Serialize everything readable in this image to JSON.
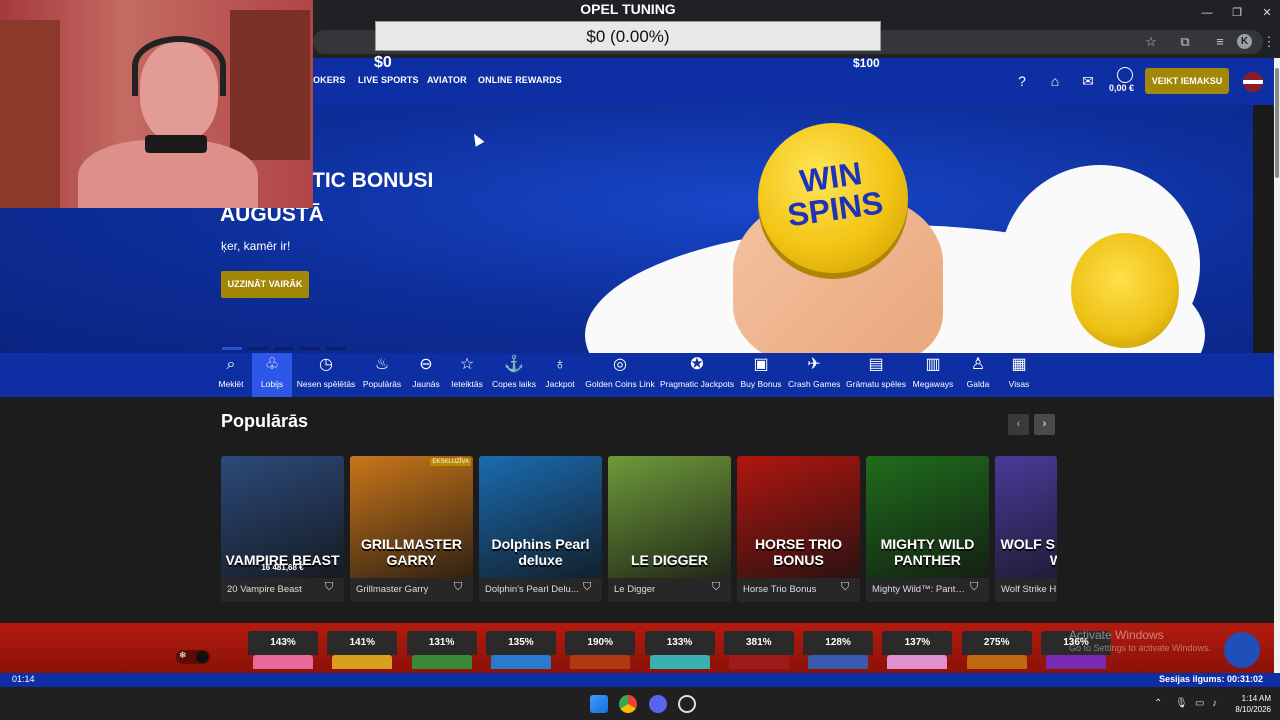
{
  "overlay": {
    "title": "OPEL TUNING",
    "progress_text": "$0 (0.00%)",
    "progress_fraction": 0.0,
    "min_label": "$0",
    "max_label": "$100"
  },
  "browser": {
    "profile_initial": "K",
    "window_controls": [
      "minimize-icon",
      "restore-icon",
      "close-icon"
    ],
    "toolbar_icons": [
      "star-icon",
      "extensions-icon",
      "media-icon",
      "menu-icon"
    ]
  },
  "header": {
    "nav": [
      "OKERS",
      "LIVE SPORTS",
      "AVIATOR",
      "ONLINE REWARDS"
    ],
    "balance": "0,00 €",
    "deposit_label": "VEIKT IEMAKSU",
    "icons": [
      "help-icon",
      "gift-icon",
      "mail-icon",
      "user-icon",
      "language-flag-icon"
    ]
  },
  "hero": {
    "title_line1": "TIC BONUSI",
    "title_line2": "AUGUSTĀ",
    "subtitle": "ķer, kamēr ir!",
    "button_label": "UZZINĀT VAIRĀK",
    "coin_text": "WIN SPINS",
    "slide_count": 5,
    "active_slide": 1
  },
  "categories": [
    {
      "label": "Meklēt",
      "icon": "search-icon",
      "glyph": "⌕"
    },
    {
      "label": "Lobijs",
      "icon": "lobby-icon",
      "glyph": "♧"
    },
    {
      "label": "Nesen spēlētās",
      "icon": "recent-icon",
      "glyph": "◷"
    },
    {
      "label": "Populārās",
      "icon": "popular-icon",
      "glyph": "♨"
    },
    {
      "label": "Jaunās",
      "icon": "new-icon",
      "glyph": "⊖"
    },
    {
      "label": "Ieteiktās",
      "icon": "star-icon",
      "glyph": "☆"
    },
    {
      "label": "Copes laiks",
      "icon": "fishing-icon",
      "glyph": "⚓"
    },
    {
      "label": "Jackpot",
      "icon": "jackpot-icon",
      "glyph": "♁"
    },
    {
      "label": "Golden Coins Link",
      "icon": "coins-icon",
      "glyph": "◎"
    },
    {
      "label": "Pragmatic Jackpots",
      "icon": "pragmatic-icon",
      "glyph": "✪"
    },
    {
      "label": "Buy Bonus",
      "icon": "wallet-icon",
      "glyph": "▣"
    },
    {
      "label": "Crash Games",
      "icon": "rocket-icon",
      "glyph": "✈"
    },
    {
      "label": "Grāmatu spēles",
      "icon": "book-icon",
      "glyph": "▤"
    },
    {
      "label": "Megaways",
      "icon": "megaways-icon",
      "glyph": "▥"
    },
    {
      "label": "Galda",
      "icon": "table-icon",
      "glyph": "♙"
    },
    {
      "label": "Visas",
      "icon": "all-games-icon",
      "glyph": "▦"
    }
  ],
  "popular": {
    "title": "Populārās",
    "prev_glyph": "‹",
    "next_glyph": "›",
    "games": [
      {
        "name": "20 Vampire Beast",
        "art": "VAMPIRE BEAST",
        "amount": "16 481,68 €",
        "color": "#2c4a7a"
      },
      {
        "name": "Grillmaster Garry",
        "art": "GRILLMASTER GARRY",
        "badge": "EKSKLUZĪVA",
        "color": "#c9761a"
      },
      {
        "name": "Dolphin's Pearl Delu...",
        "art": "Dolphins Pearl deluxe",
        "color": "#1a6bb0"
      },
      {
        "name": "Le Digger",
        "art": "LE DIGGER",
        "color": "#6e9a3a"
      },
      {
        "name": "Horse Trio Bonus",
        "art": "HORSE TRIO BONUS",
        "color": "#b0160f"
      },
      {
        "name": "Mighty Wild™: Panth...",
        "art": "MIGHTY WILD PANTHER",
        "color": "#1f6d1c"
      },
      {
        "name": "Wolf Strike H",
        "art": "WOLF S HOLD N W",
        "color": "#4a3a9a"
      }
    ]
  },
  "hot": {
    "percentages": [
      "143%",
      "141%",
      "131%",
      "135%",
      "190%",
      "133%",
      "381%",
      "128%",
      "137%",
      "275%",
      "136%"
    ],
    "thumb_colors": [
      "#e86a9a",
      "#d9a020",
      "#3a8a3a",
      "#2a7bd0",
      "#b03a10",
      "#3ab0b0",
      "#a01a1a",
      "#3a5ab0",
      "#e090d0",
      "#c06a10",
      "#7a2ab0"
    ]
  },
  "watermark": {
    "line1": "Activate Windows",
    "line2": "Go to Settings to activate Windows."
  },
  "status": {
    "elapsed": "01:14",
    "session": "Sesijas ilgums: 00:31:02"
  },
  "taskbar": {
    "time": "1:14 AM",
    "date": "8/10/2026",
    "apps": [
      "windows-start-icon",
      "chrome-icon",
      "discord-icon",
      "obs-icon"
    ],
    "tray": [
      "chevron-up-icon",
      "mic-icon",
      "network-icon",
      "volume-icon"
    ]
  }
}
